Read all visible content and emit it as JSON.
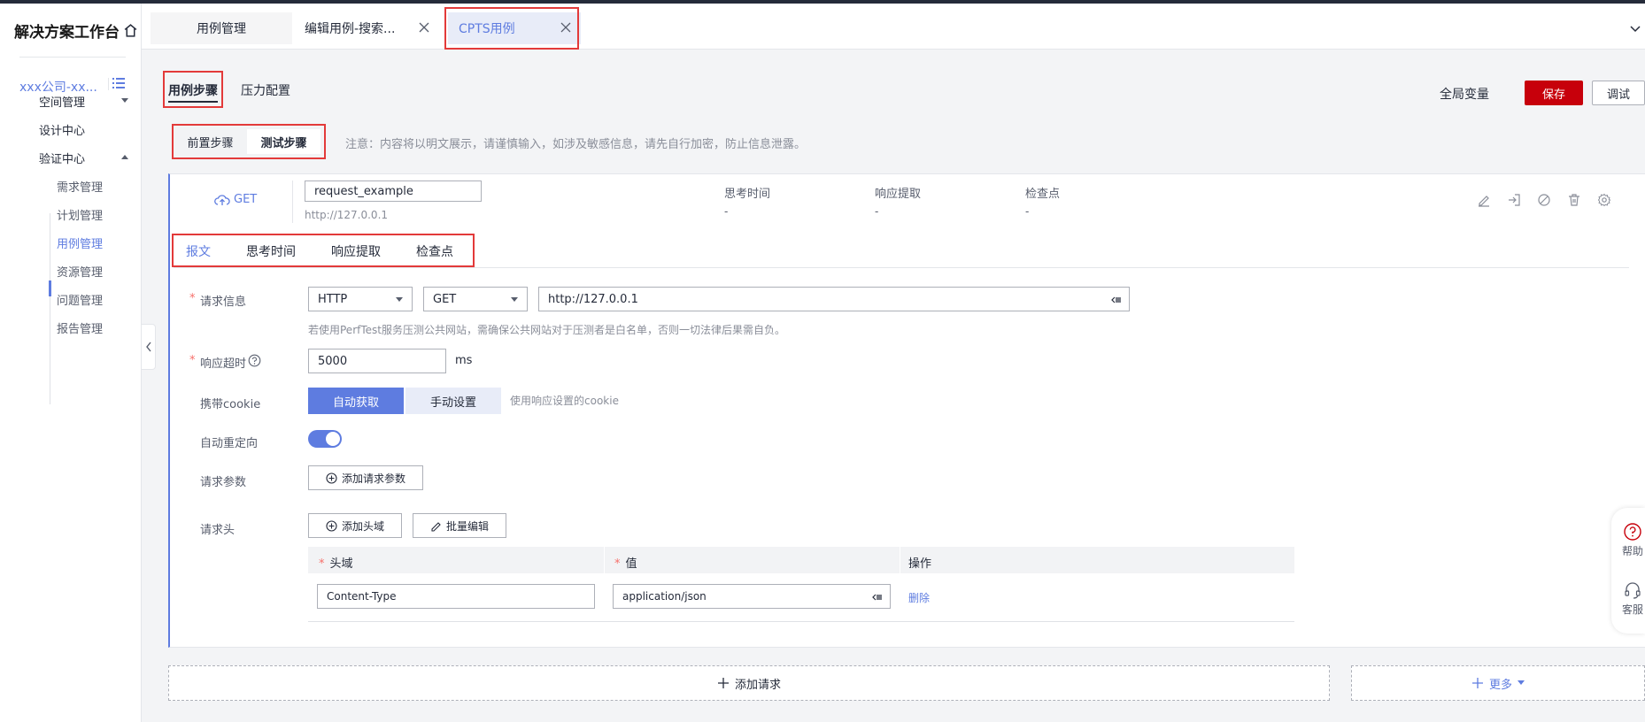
{
  "sidebar": {
    "brand": "解决方案工作台",
    "brand_icon": "home-icon",
    "company": "xxx公司-xx...",
    "company_icon": "list-icon",
    "nav": [
      {
        "label": "空间管理",
        "arrow": "down"
      },
      {
        "label": "设计中心"
      },
      {
        "label": "验证中心",
        "arrow": "up"
      }
    ],
    "subnav": [
      {
        "label": "需求管理"
      },
      {
        "label": "计划管理"
      },
      {
        "label": "用例管理",
        "active": true
      },
      {
        "label": "资源管理"
      },
      {
        "label": "问题管理"
      },
      {
        "label": "报告管理"
      }
    ]
  },
  "tabs": [
    {
      "label": "用例管理"
    },
    {
      "label": "编辑用例-搜索..."
    },
    {
      "label": "CPTS用例",
      "active": true
    }
  ],
  "page_tabs": [
    {
      "label": "用例步骤",
      "active": true
    },
    {
      "label": "压力配置"
    }
  ],
  "header_actions": {
    "global_vars": "全局变量",
    "save": "保存",
    "debug": "调试"
  },
  "steps": {
    "pre": "前置步骤",
    "test": "测试步骤",
    "notice": "注意：内容将以明文展示，请谨慎输入，如涉及敏感信息，请先自行加密，防止信息泄露。"
  },
  "request_card": {
    "method": "GET",
    "name": "request_example",
    "url": "http://127.0.0.1",
    "meta": [
      {
        "label": "思考时间",
        "value": "-"
      },
      {
        "label": "响应提取",
        "value": "-"
      },
      {
        "label": "检查点",
        "value": "-"
      }
    ],
    "action_icons": [
      "edit-icon",
      "export-icon",
      "disable-icon",
      "delete-icon",
      "settings-icon"
    ]
  },
  "sub_tabs": [
    {
      "label": "报文",
      "active": true
    },
    {
      "label": "思考时间"
    },
    {
      "label": "响应提取"
    },
    {
      "label": "检查点"
    }
  ],
  "form": {
    "request_info_label": "请求信息",
    "protocol": "HTTP",
    "method": "GET",
    "url": "http://127.0.0.1",
    "hint": "若使用PerfTest服务压测公共网站，需确保公共网站对于压测者是白名单，否则一切法律后果需自负。",
    "timeout_label": "响应超时",
    "timeout_value": "5000",
    "timeout_unit": "ms",
    "cookie_label": "携带cookie",
    "cookie_auto": "自动获取",
    "cookie_manual": "手动设置",
    "cookie_hint": "使用响应设置的cookie",
    "redirect_label": "自动重定向",
    "redirect_on": true,
    "params_label": "请求参数",
    "add_params": "添加请求参数",
    "headers_label": "请求头",
    "add_header": "添加头域",
    "batch_edit": "批量编辑",
    "table": {
      "col_key": "头域",
      "col_value": "值",
      "col_action": "操作",
      "rows": [
        {
          "key": "Content-Type",
          "value": "application/json",
          "action": "删除"
        }
      ]
    }
  },
  "bottom": {
    "add_request": "添加请求",
    "more": "更多"
  },
  "float": {
    "help": "帮助",
    "service": "客服"
  },
  "colors": {
    "accent": "#5e7ce0",
    "save": "#c7000b",
    "highlight": "#e33a3a"
  }
}
